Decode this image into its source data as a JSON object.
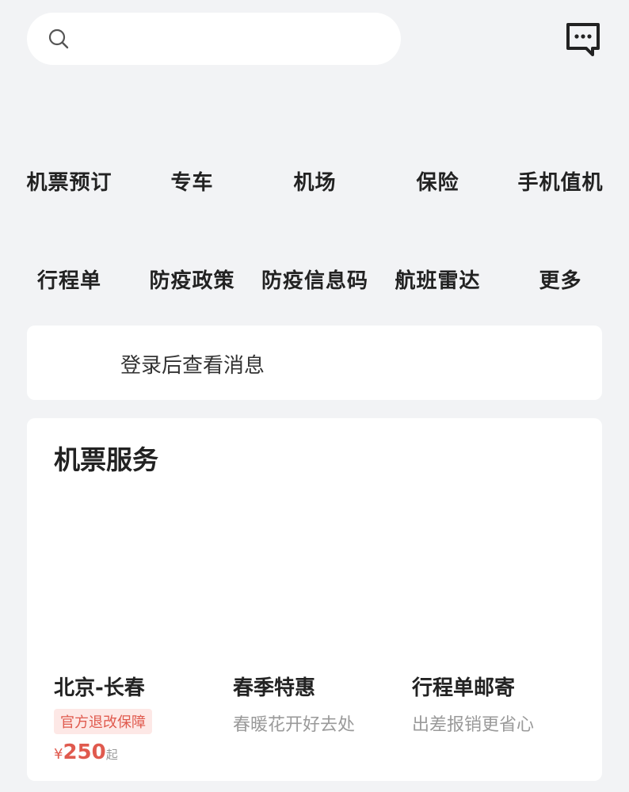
{
  "search": {
    "value": "",
    "placeholder": ""
  },
  "icons": {
    "search": "search-icon",
    "message": "message-icon"
  },
  "nav": {
    "row1": [
      "机票预订",
      "专车",
      "机场",
      "保险",
      "手机值机"
    ],
    "row2": [
      "行程单",
      "防疫政策",
      "防疫信息码",
      "航班雷达",
      "更多"
    ]
  },
  "notice": {
    "text": "登录后查看消息"
  },
  "service": {
    "title": "机票服务",
    "cards": [
      {
        "title": "北京-长春",
        "tag": "官方退改保障",
        "currency": "¥",
        "price": "250",
        "price_suffix": "起"
      },
      {
        "title": "春季特惠",
        "subtitle": "春暖花开好去处"
      },
      {
        "title": "行程单邮寄",
        "subtitle": "出差报销更省心"
      }
    ]
  },
  "colors": {
    "background": "#f2f3f5",
    "accent": "#e05a4e",
    "tag_bg": "#fde8e6",
    "muted": "#9a9a9a"
  }
}
